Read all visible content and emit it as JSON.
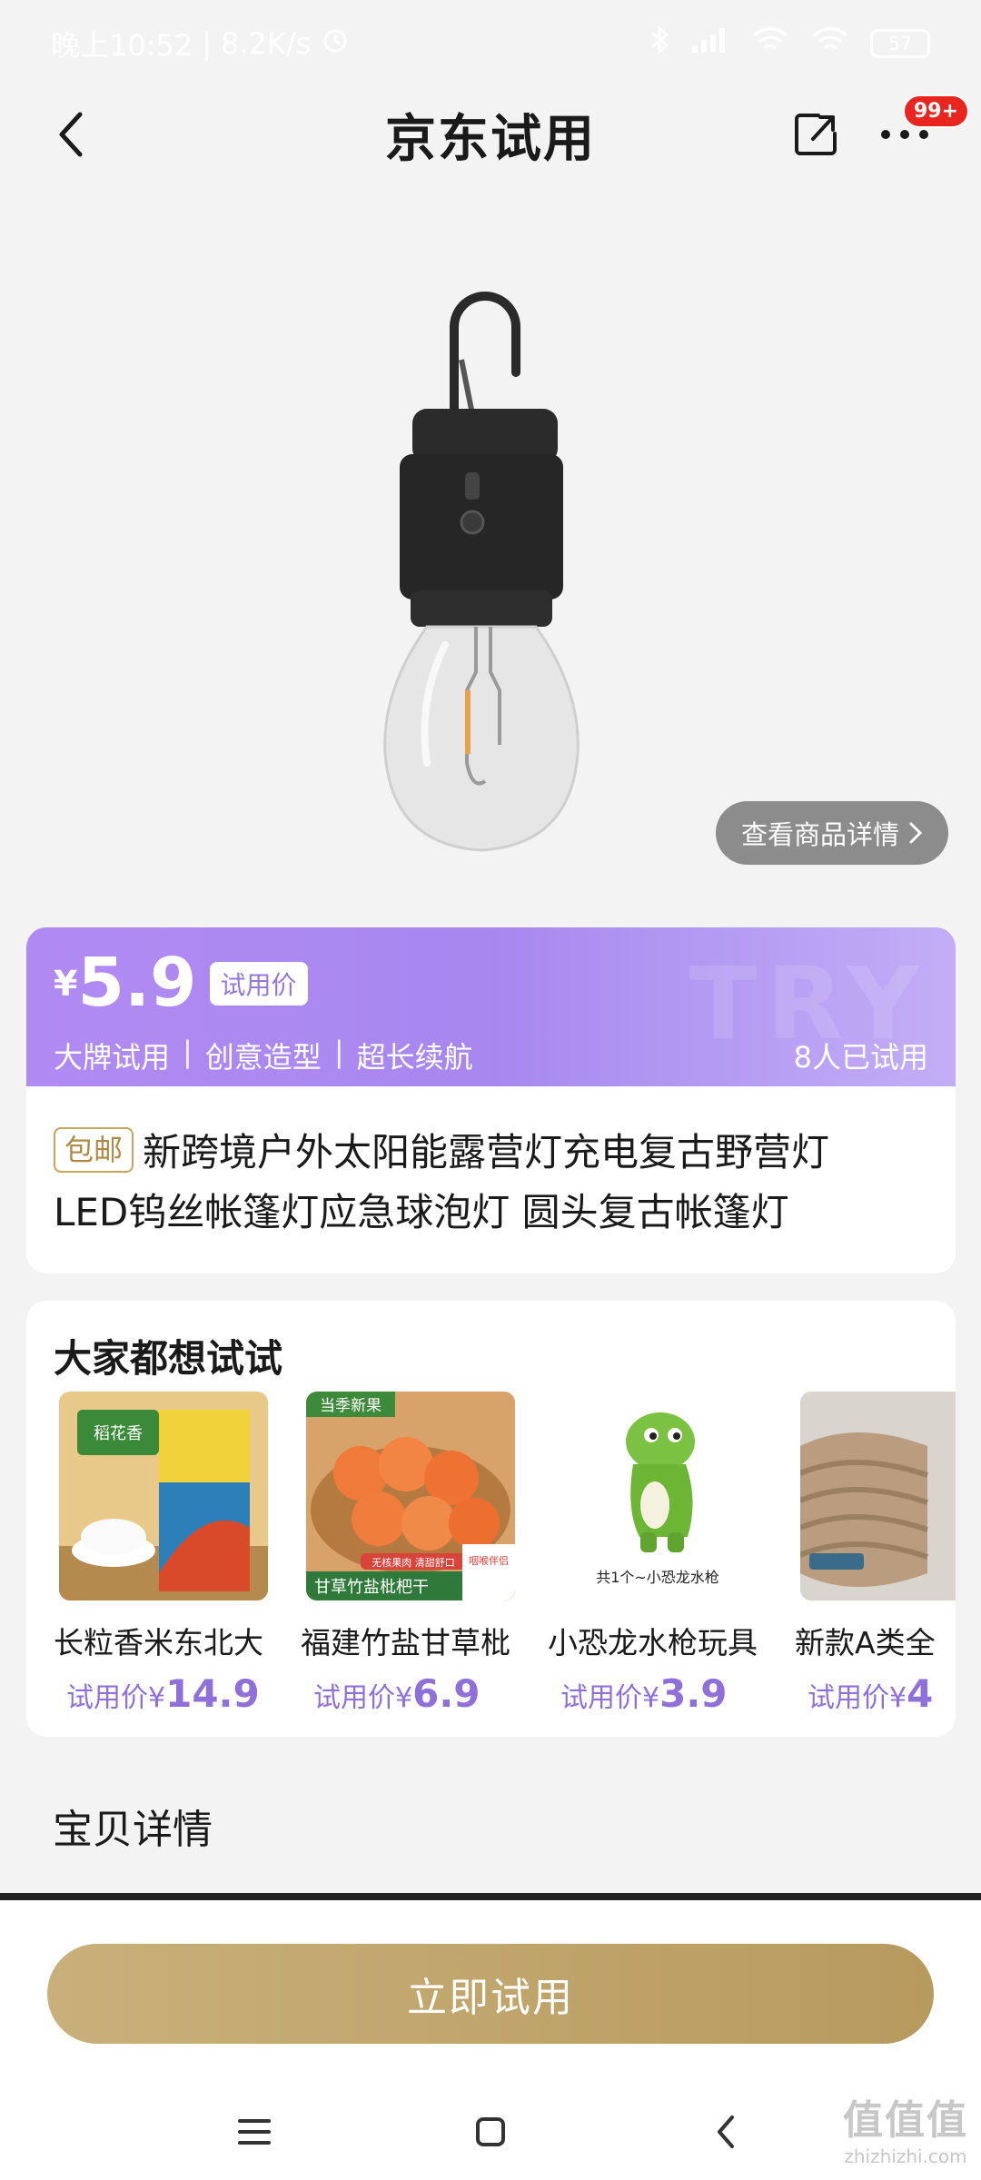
{
  "status_bar": {
    "time": "晚上10:52",
    "speed": "8.2K/s",
    "battery": "57"
  },
  "header": {
    "title": "京东试用",
    "badge": "99+"
  },
  "product": {
    "detail_link": "查看商品详情"
  },
  "price_banner": {
    "currency": "¥",
    "price": "5.9",
    "price_tag": "试用价",
    "features": [
      "大牌试用",
      "创意造型",
      "超长续航"
    ],
    "separator": "|",
    "tried_count": "8人已试用",
    "watermark": "TRY"
  },
  "title_card": {
    "shipping_tag": "包邮",
    "line1": "新跨境户外太阳能露营灯充电复古野营灯",
    "line2": "LED钨丝帐篷灯应急球泡灯 圆头复古帐篷灯"
  },
  "recommend": {
    "title": "大家都想试试",
    "items": [
      {
        "name": "长粒香米东北大",
        "price_label": "试用价¥",
        "price": "14.9"
      },
      {
        "name": "福建竹盐甘草枇",
        "price_label": "试用价¥",
        "price": "6.9"
      },
      {
        "name": "小恐龙水枪玩具",
        "price_label": "试用价¥",
        "price": "3.9"
      },
      {
        "name": "新款A类全",
        "price_label": "试用价¥",
        "price": "4"
      }
    ],
    "thumb_texts": {
      "rice_banner": "稻花香",
      "loquat_top": "当季新果",
      "loquat_bottom": "甘草竹盐枇杷干",
      "loquat_side": "咽喉伴侣",
      "loquat_strip": "无核果肉 清甜舒口",
      "dino": "共1个~小恐龙水枪"
    }
  },
  "section": {
    "title": "宝贝详情"
  },
  "cta": {
    "label": "立即试用"
  },
  "watermark": {
    "text": "值值值",
    "domain": "zhizhizhi.com"
  }
}
